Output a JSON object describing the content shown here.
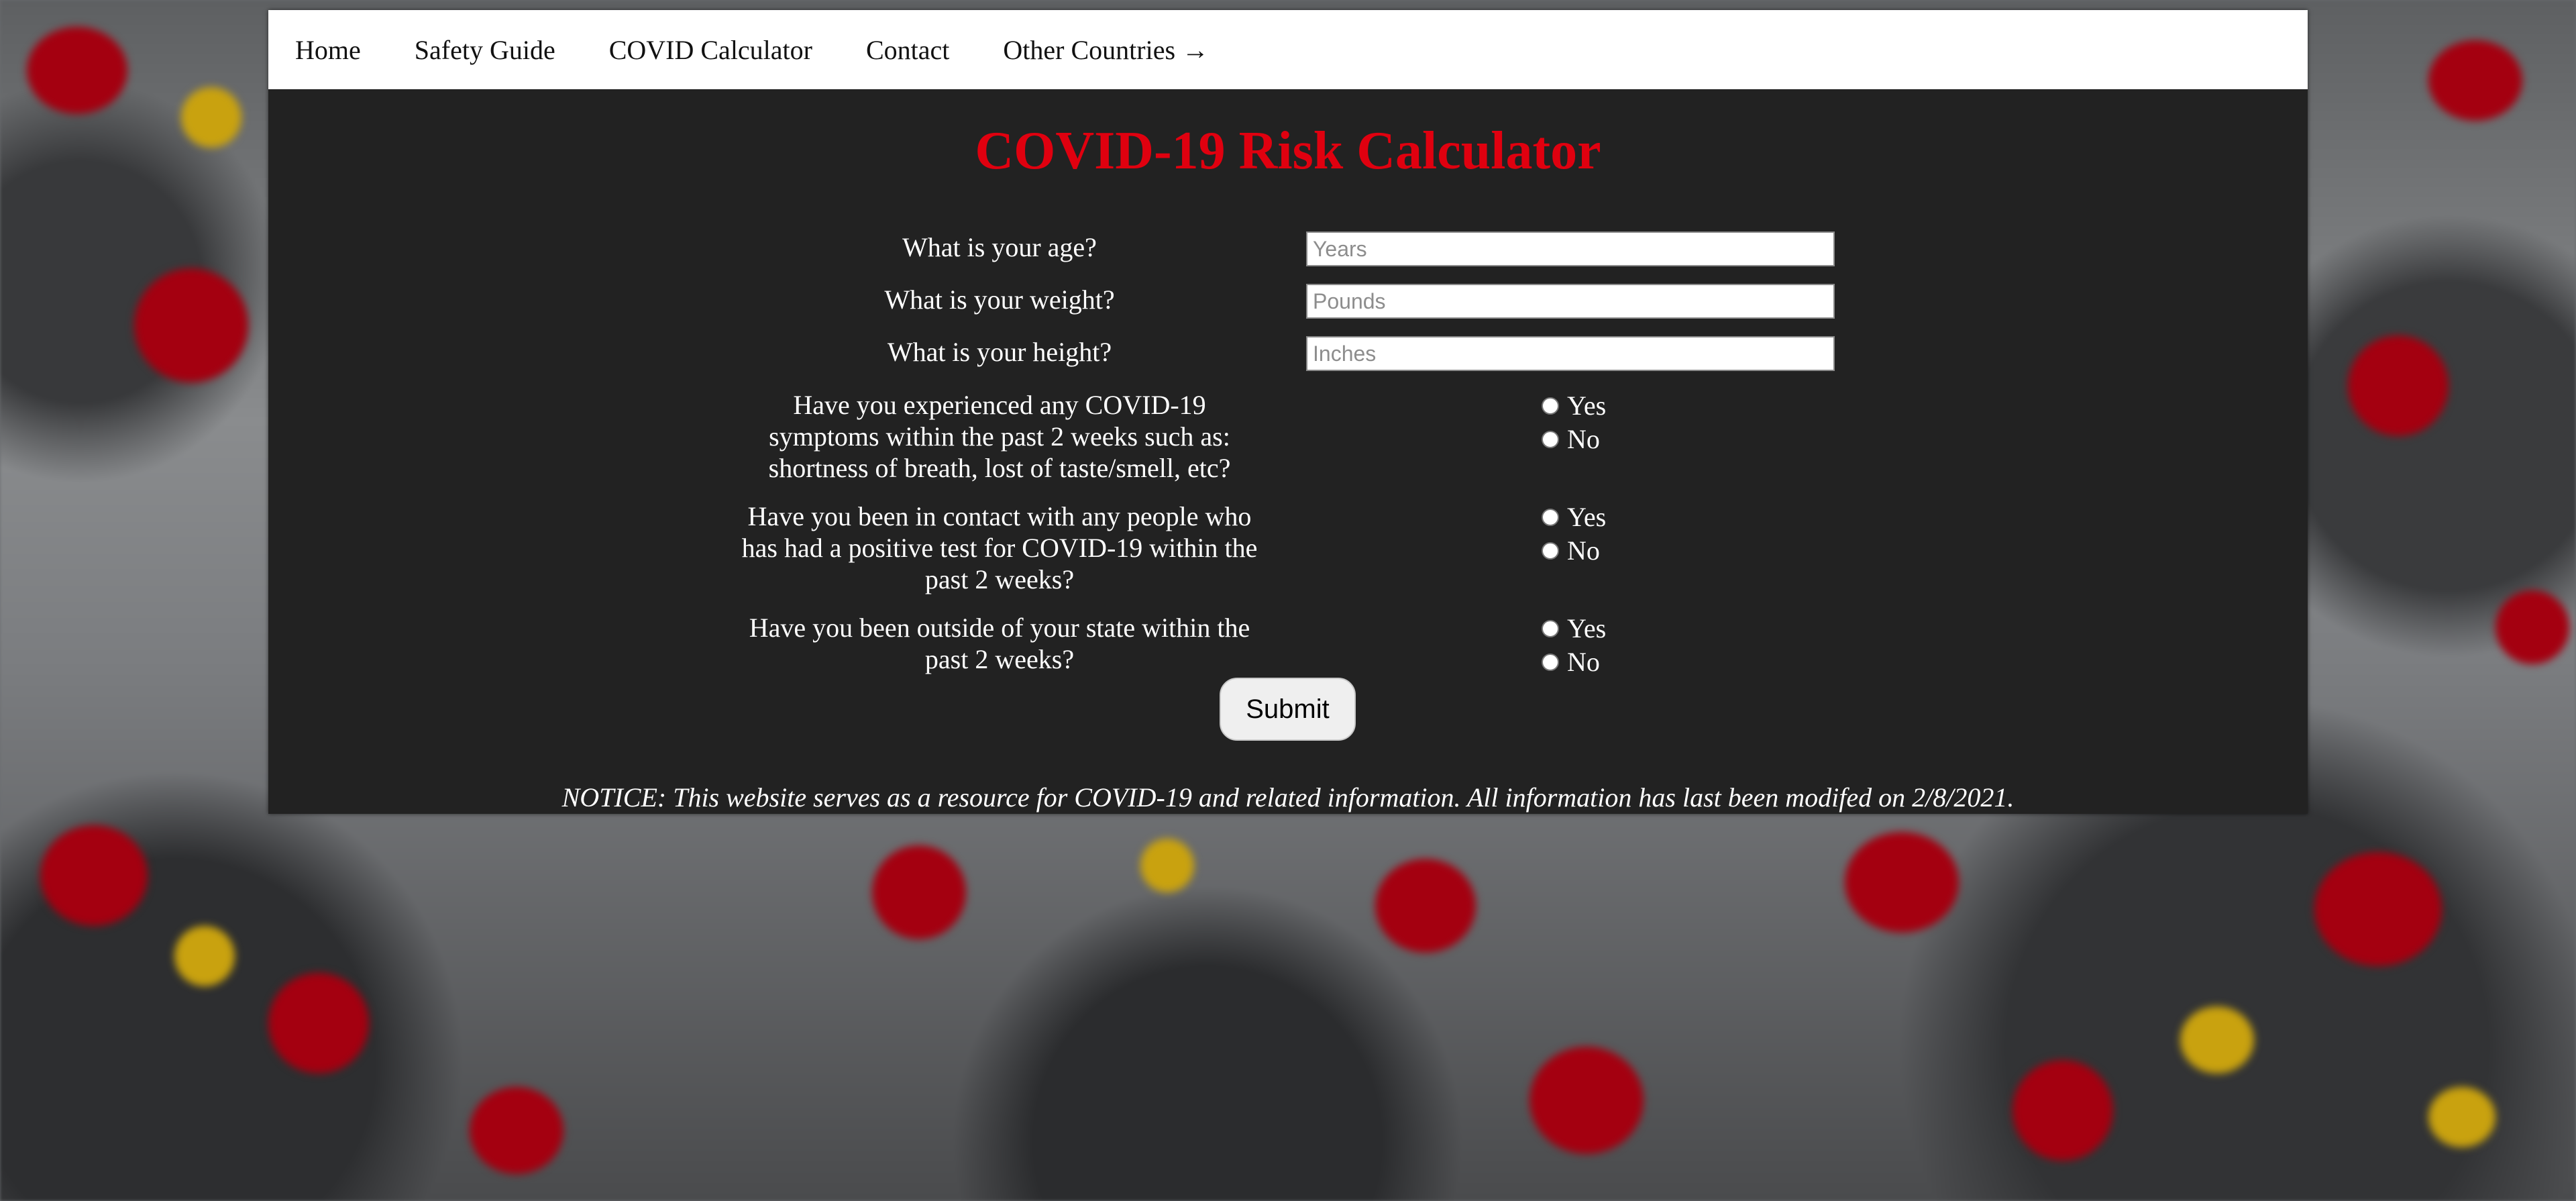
{
  "nav": {
    "items": [
      {
        "label": "Home"
      },
      {
        "label": "Safety Guide"
      },
      {
        "label": "COVID Calculator"
      },
      {
        "label": "Contact"
      },
      {
        "label": "Other Countries →"
      }
    ]
  },
  "page": {
    "title": "COVID-19 Risk Calculator",
    "title_color": "#e0000f"
  },
  "form": {
    "age": {
      "label": "What is your age?",
      "placeholder": "Years",
      "value": ""
    },
    "weight": {
      "label": "What is your weight?",
      "placeholder": "Pounds",
      "value": ""
    },
    "height": {
      "label": "What is your height?",
      "placeholder": "Inches",
      "value": ""
    },
    "symptoms": {
      "label_lines": [
        "Have you experienced any COVID-19",
        "symptoms within the past 2 weeks such as:",
        "shortness of breath, lost of taste/smell, etc?"
      ],
      "options": [
        "Yes",
        "No"
      ]
    },
    "contact": {
      "label_lines": [
        "Have you been in contact with any people who",
        "has had a positive test for COVID-19 within the",
        "past 2 weeks?"
      ],
      "options": [
        "Yes",
        "No"
      ]
    },
    "travel": {
      "label_lines": [
        "Have you been outside of your state within the",
        "past 2 weeks?"
      ],
      "options": [
        "Yes",
        "No"
      ]
    },
    "submit_label": "Submit"
  },
  "footer": {
    "notice": "NOTICE: This website serves as a resource for COVID-19 and related information. All information has last been modifed on 2/8/2021."
  }
}
